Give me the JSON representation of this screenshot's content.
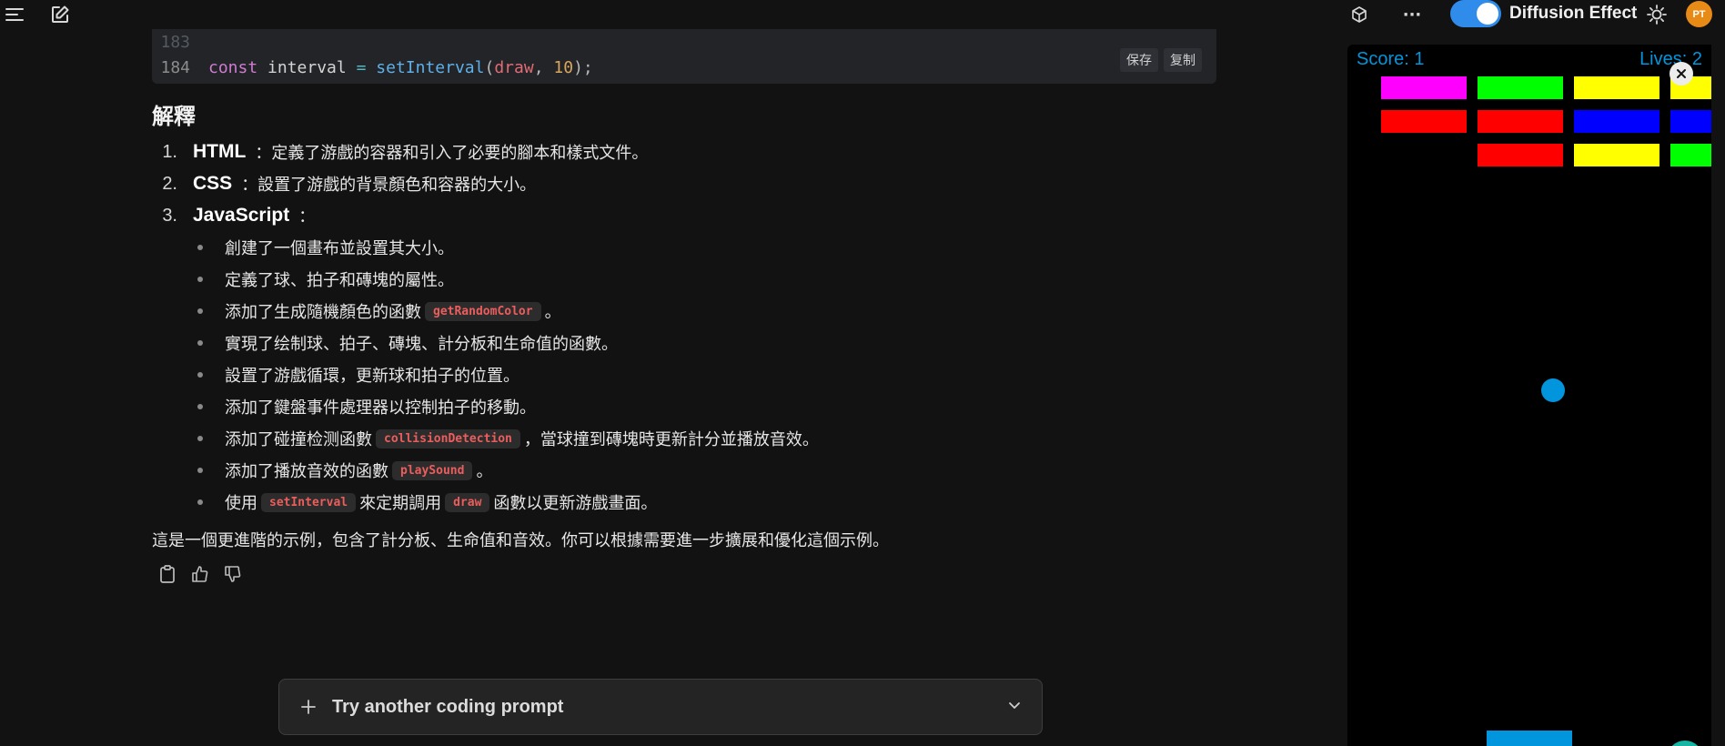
{
  "topbar": {
    "menu_icon": "hamburger-icon",
    "new_chat_icon": "edit-icon",
    "cube_icon": "cube-icon",
    "more_label": "···",
    "toggle_label": "Diffusion Effect",
    "toggle_on": true,
    "theme_icon": "sun-icon",
    "avatar_initials": "PT"
  },
  "code": {
    "lines": [
      {
        "num": "183",
        "text": ""
      },
      {
        "num": "184",
        "tokens": {
          "kw": "const",
          "var": "interval",
          "op": "=",
          "fn": "setInterval",
          "open": "(",
          "arg": "draw",
          "comma": ",",
          "num": "10",
          "close": ");"
        }
      }
    ],
    "save_label": "保存",
    "copy_label": "复制"
  },
  "explain": {
    "heading": "解釋",
    "items": [
      {
        "num": "1.",
        "strong": "HTML",
        "rest": "：定義了游戲的容器和引入了必要的腳本和樣式文件。"
      },
      {
        "num": "2.",
        "strong": "CSS",
        "rest": "：設置了游戲的背景顏色和容器的大小。"
      },
      {
        "num": "3.",
        "strong": "JavaScript",
        "rest": "："
      }
    ],
    "bullets": [
      {
        "pre": "創建了一個畫布並設置其大小。"
      },
      {
        "pre": "定義了球、拍子和磚塊的屬性。"
      },
      {
        "pre": "添加了生成隨機顏色的函數",
        "code": "getRandomColor",
        "post": "。"
      },
      {
        "pre": "實現了绘制球、拍子、磚塊、計分板和生命值的函數。"
      },
      {
        "pre": "設置了游戲循環，更新球和拍子的位置。"
      },
      {
        "pre": "添加了鍵盤事件處理器以控制拍子的移動。"
      },
      {
        "pre": "添加了碰撞检测函數",
        "code": "collisionDetection",
        "post": "，當球撞到磚塊時更新計分並播放音效。"
      },
      {
        "pre": "添加了播放音效的函數",
        "code": "playSound",
        "post": "。"
      },
      {
        "pre": "使用",
        "code": "setInterval",
        "mid": "來定期調用",
        "code2": "draw",
        "post": "函數以更新游戲畫面。"
      }
    ],
    "summary": "這是一個更進階的示例，包含了計分板、生命值和音效。你可以根據需要進一步擴展和優化這個示例。",
    "action_icons": [
      "clipboard-icon",
      "thumbs-up-icon",
      "thumbs-down-icon"
    ]
  },
  "prompt": {
    "label": "Try another coding prompt",
    "plus_icon": "plus-icon",
    "chevron_icon": "chevron-down-icon"
  },
  "game": {
    "score_text": "Score: 1",
    "lives_text": "Lives: 2",
    "close_icon": "close-icon",
    "bricks": [
      [
        "#ff00ff",
        "#00ff00",
        "#ffff00",
        "#ffff00"
      ],
      [
        "#ff0000",
        "#ff0000",
        "#0000ff",
        "#0000ff"
      ],
      [
        null,
        "#ff0000",
        "#ffff00",
        "#00ff00"
      ]
    ],
    "ball_color": "#0095dd",
    "paddle_color": "#0095dd"
  }
}
